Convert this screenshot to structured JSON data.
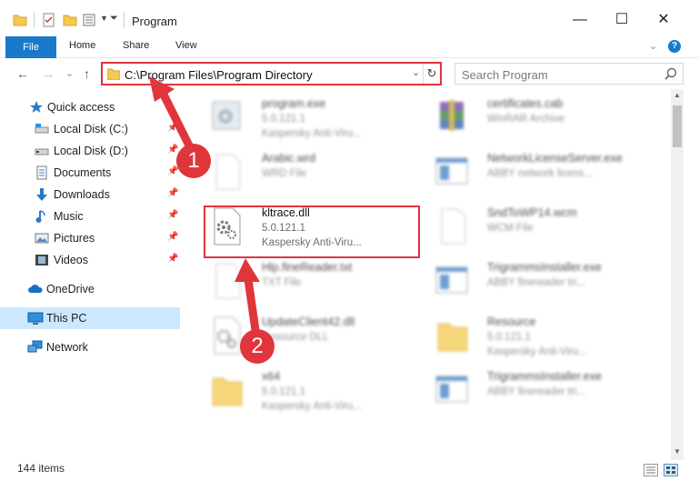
{
  "window": {
    "title": "Program",
    "minimize_glyph": "—",
    "maximize_glyph": "☐",
    "close_glyph": "✕"
  },
  "ribbon": {
    "file": "File",
    "home": "Home",
    "share": "Share",
    "view": "View",
    "expand_glyph": "⌄",
    "help_glyph": "?"
  },
  "address": {
    "path": "C:\\Program Files\\Program Directory",
    "dropdown_glyph": "⌄",
    "refresh_glyph": "↻"
  },
  "search": {
    "placeholder": "Search Program"
  },
  "nav_glyphs": {
    "back": "←",
    "forward": "→",
    "recent": "⌄",
    "up": "↑"
  },
  "sidebar": {
    "pin_glyph": "📌",
    "items": [
      {
        "label": "Quick access",
        "icon": "star-icon"
      },
      {
        "label": "Local Disk (C:)",
        "icon": "drive-icon"
      },
      {
        "label": "Local Disk (D:)",
        "icon": "drive-icon"
      },
      {
        "label": "Documents",
        "icon": "documents-icon"
      },
      {
        "label": "Downloads",
        "icon": "download-icon"
      },
      {
        "label": "Music",
        "icon": "music-icon"
      },
      {
        "label": "Pictures",
        "icon": "pictures-icon"
      },
      {
        "label": "Videos",
        "icon": "videos-icon"
      },
      {
        "label": "OneDrive",
        "icon": "cloud-icon"
      },
      {
        "label": "This PC",
        "icon": "pc-icon"
      },
      {
        "label": "Network",
        "icon": "network-icon"
      }
    ]
  },
  "files": [
    {
      "name": "program.exe",
      "type": "5.0.121.1",
      "desc": "Kaspersky Anti-Viru...",
      "icon": "exe-icon"
    },
    {
      "name": "certificates.cab",
      "type": "WinRAR Archive",
      "desc": "",
      "icon": "archive-icon"
    },
    {
      "name": "Arabic.wrd",
      "type": "WRD File",
      "desc": "",
      "icon": "blank-file-icon"
    },
    {
      "name": "NetworkLicenseServer.exe",
      "type": "ABBY network licens...",
      "desc": "",
      "icon": "window-icon"
    },
    {
      "name": "kltrace.dll",
      "type": "5.0.121.1",
      "desc": "Kaspersky Anti-Viru...",
      "icon": "dll-gear-icon"
    },
    {
      "name": "SndToWP14.wcm",
      "type": "WCM File",
      "desc": "",
      "icon": "blank-file-icon"
    },
    {
      "name": "Hlp.fineReader.txt",
      "type": "TXT File",
      "desc": "",
      "icon": "blank-file-icon"
    },
    {
      "name": "TrigrammsInstaller.exe",
      "type": "ABBY finereader tri...",
      "desc": "",
      "icon": "window-icon"
    },
    {
      "name": "UpdateClient42.dll",
      "type": "Resource DLL",
      "desc": "",
      "icon": "dll-gear-icon"
    },
    {
      "name": "Resource",
      "type": "5.0.121.1",
      "desc": "Kaspersky Anti-Viru...",
      "icon": "folder-icon"
    },
    {
      "name": "x64",
      "type": "5.0.121.1",
      "desc": "Kaspersky Anti-Viru...",
      "icon": "folder-icon"
    },
    {
      "name": "TrigrammsInstaller.exe",
      "type": "ABBY finereader tri...",
      "desc": "",
      "icon": "window-icon"
    }
  ],
  "status": {
    "count": "144 items"
  },
  "callouts": [
    "1",
    "2"
  ],
  "colors": {
    "accent": "#1979ca",
    "highlight": "#e0353b",
    "selected": "#cce8ff"
  }
}
